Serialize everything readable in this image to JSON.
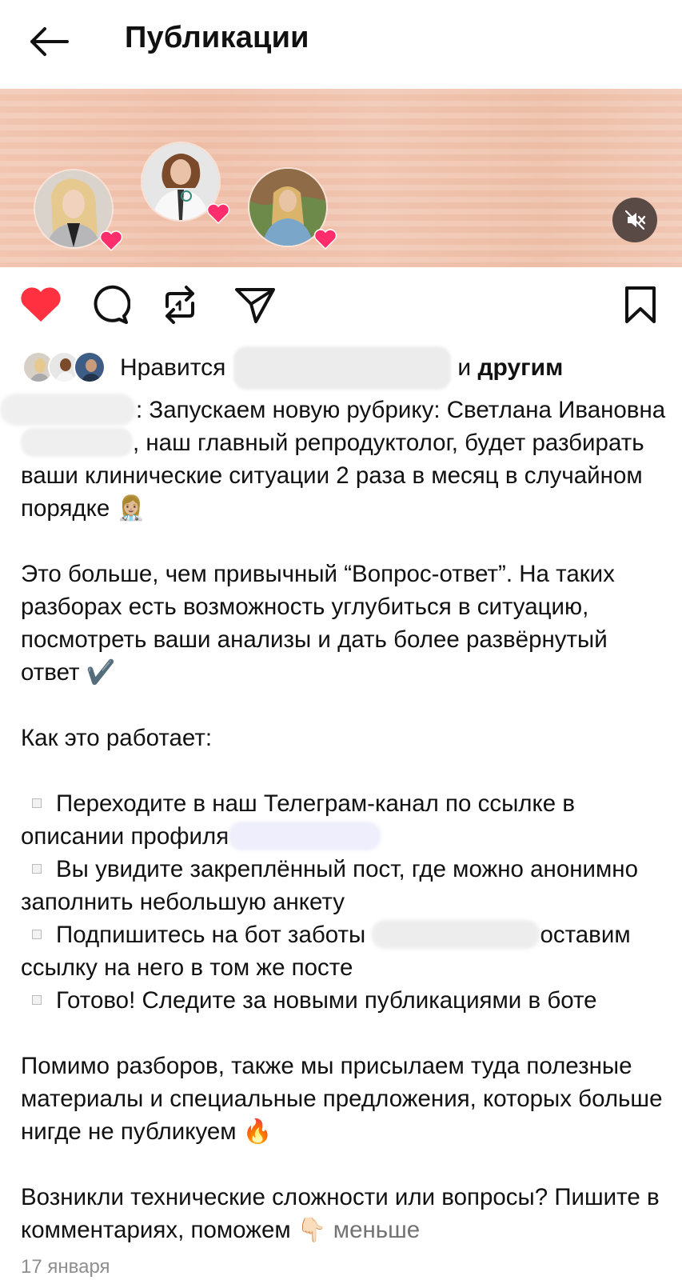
{
  "header": {
    "title": "Публикации",
    "back_icon": "arrow-left-icon"
  },
  "media": {
    "mute_icon": "speaker-muted-icon",
    "avatars": [
      {
        "name": "avatar-1",
        "badge": "heart-icon"
      },
      {
        "name": "avatar-2",
        "badge": "heart-icon"
      },
      {
        "name": "avatar-3",
        "badge": "heart-icon"
      }
    ]
  },
  "actions": {
    "like_icon": "heart-filled-icon",
    "comment_icon": "comment-icon",
    "repost_icon": "repost-icon",
    "share_icon": "send-icon",
    "save_icon": "bookmark-icon",
    "like_color": "#ff3040"
  },
  "likes": {
    "prefix": "Нравится",
    "conj": "и",
    "others": "другим"
  },
  "caption": {
    "line1": ": Запускаем новую рубрику: Светлана Ивановна",
    "line1b": ", наш главный репродуктолог, будет разбирать ваши клинические ситуации 2 раза в месяц в случайном порядке 👩🏼‍⚕️",
    "para2": "Это больше, чем привычный “Вопрос-ответ”. На таких разборах есть возможность углубиться в ситуацию, посмотреть ваши анализы и дать более развёрнутый ответ ✔️",
    "para3": "Как это работает:",
    "bullet1": "Переходите в наш Телеграм-канал по ссылке в описании профиля",
    "bullet2": "Вы увидите закреплённый пост, где можно анонимно заполнить небольшую анкету",
    "bullet3a": "Подпишитесь на бот заботы",
    "bullet3b": "оставим ссылку на него в том же посте",
    "bullet4": "Готово! Следите за новыми публикациями в боте",
    "para5": "Помимо разборов, также мы присылаем туда полезные материалы и специальные предложения, которых больше нигде не публикуем 🔥",
    "para6": "Возникли технические сложности или вопросы? Пишите в комментариях, поможем 👇🏻",
    "less": "меньше"
  },
  "date": "17 января"
}
